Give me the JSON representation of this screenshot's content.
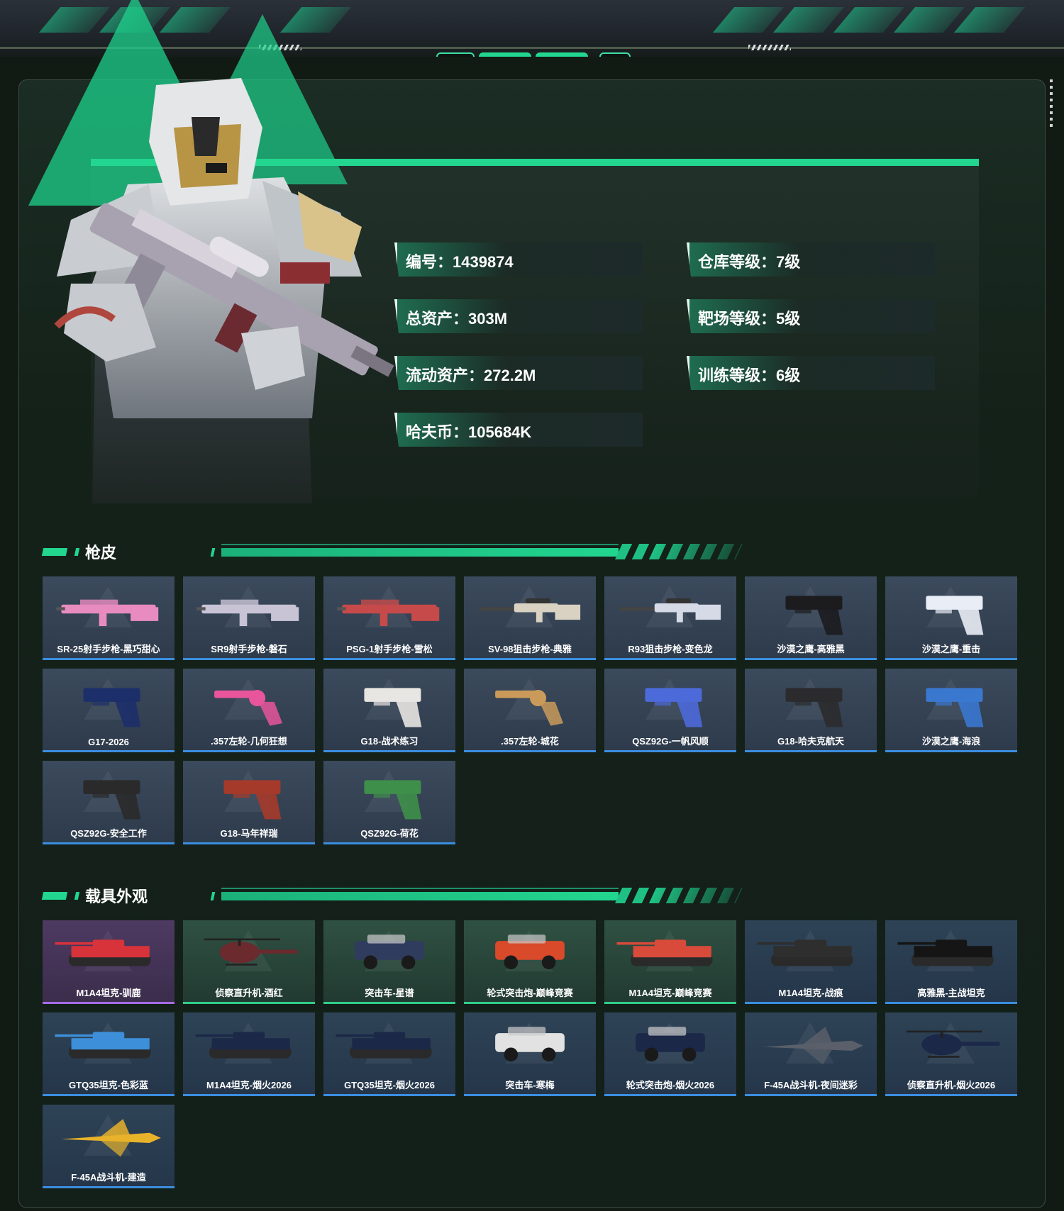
{
  "header": {
    "accent_color": "#22d68f"
  },
  "profile": {
    "stats": [
      {
        "id": "id",
        "text": "编号：1439874"
      },
      {
        "id": "warehouse-level",
        "text": "仓库等级：7级"
      },
      {
        "id": "total-assets",
        "text": "总资产：303M"
      },
      {
        "id": "range-level",
        "text": "靶场等级：5级"
      },
      {
        "id": "liquid-assets",
        "text": "流动资产：272.2M"
      },
      {
        "id": "training-level",
        "text": "训练等级：6级"
      },
      {
        "id": "havoc-coins",
        "text": "哈夫币：105684K"
      }
    ]
  },
  "gun_skins": {
    "title": "枪皮",
    "items": [
      {
        "label": "SR-25射手步枪-黑巧甜心",
        "kind": "rifle",
        "color": "#e88bbf"
      },
      {
        "label": "SR9射手步枪-磐石",
        "kind": "rifle",
        "color": "#c9c3d6"
      },
      {
        "label": "PSG-1射手步枪-雪松",
        "kind": "rifle",
        "color": "#c64a4a"
      },
      {
        "label": "SV-98狙击步枪-典雅",
        "kind": "sniper",
        "color": "#d9d2c2"
      },
      {
        "label": "R93狙击步枪-变色龙",
        "kind": "sniper",
        "color": "#d6d9e6"
      },
      {
        "label": "沙漠之鹰-高雅黑",
        "kind": "pistol",
        "color": "#1c1c1f"
      },
      {
        "label": "沙漠之鹰-重击",
        "kind": "pistol",
        "color": "#e9edf5"
      },
      {
        "label": "G17-2026",
        "kind": "pistol",
        "color": "#1d2f6a"
      },
      {
        "label": ".357左轮-几何狂想",
        "kind": "revolver",
        "color": "#e8559b"
      },
      {
        "label": "G18-战术练习",
        "kind": "pistol",
        "color": "#e8e6e2"
      },
      {
        "label": ".357左轮-城花",
        "kind": "revolver",
        "color": "#c99a5a"
      },
      {
        "label": "QSZ92G-一帆风顺",
        "kind": "pistol",
        "color": "#4c6ad9"
      },
      {
        "label": "G18-哈夫克航天",
        "kind": "pistol",
        "color": "#2b2b2e"
      },
      {
        "label": "沙漠之鹰-海浪",
        "kind": "pistol",
        "color": "#3a78d0"
      },
      {
        "label": "QSZ92G-安全工作",
        "kind": "pistol",
        "color": "#2a2a2a"
      },
      {
        "label": "G18-马年祥瑞",
        "kind": "pistol",
        "color": "#a63a2a"
      },
      {
        "label": "QSZ92G-荷花",
        "kind": "pistol",
        "color": "#3e8f4a"
      }
    ]
  },
  "vehicle_skins": {
    "title": "载具外观",
    "items": [
      {
        "label": "M1A4坦克-驯鹿",
        "kind": "tank",
        "color": "#d8333b",
        "frame": "purple"
      },
      {
        "label": "侦察直升机-酒红",
        "kind": "heli",
        "color": "#6a2a2e",
        "frame": "green"
      },
      {
        "label": "突击车-星谱",
        "kind": "car",
        "color": "#2f3c5e",
        "frame": "green"
      },
      {
        "label": "轮式突击炮-巅峰竞赛",
        "kind": "car",
        "color": "#d84a2a",
        "frame": "green"
      },
      {
        "label": "M1A4坦克-巅峰竞赛",
        "kind": "tank",
        "color": "#d84a3a",
        "frame": "green"
      },
      {
        "label": "M1A4坦克-战痕",
        "kind": "tank",
        "color": "#2e2e2e",
        "frame": "blue"
      },
      {
        "label": "高雅黑-主战坦克",
        "kind": "tank",
        "color": "#151515",
        "frame": "blue"
      },
      {
        "label": "GTQ35坦克-色彩蓝",
        "kind": "tank",
        "color": "#3d8fd9",
        "frame": "blue"
      },
      {
        "label": "M1A4坦克-烟火2026",
        "kind": "tank",
        "color": "#1c2848",
        "frame": "blue"
      },
      {
        "label": "GTQ35坦克-烟火2026",
        "kind": "tank",
        "color": "#1c2848",
        "frame": "blue"
      },
      {
        "label": "突击车-寒梅",
        "kind": "car",
        "color": "#e2e2e2",
        "frame": "blue"
      },
      {
        "label": "轮式突击炮-烟火2026",
        "kind": "car",
        "color": "#1c2848",
        "frame": "blue"
      },
      {
        "label": "F-45A战斗机-夜间迷彩",
        "kind": "jet",
        "color": "#5a5f6a",
        "frame": "blue"
      },
      {
        "label": "侦察直升机-烟火2026",
        "kind": "heli",
        "color": "#1c2848",
        "frame": "blue"
      },
      {
        "label": "F-45A战斗机-建造",
        "kind": "jet",
        "color": "#e8b22a",
        "frame": "blue"
      }
    ]
  }
}
